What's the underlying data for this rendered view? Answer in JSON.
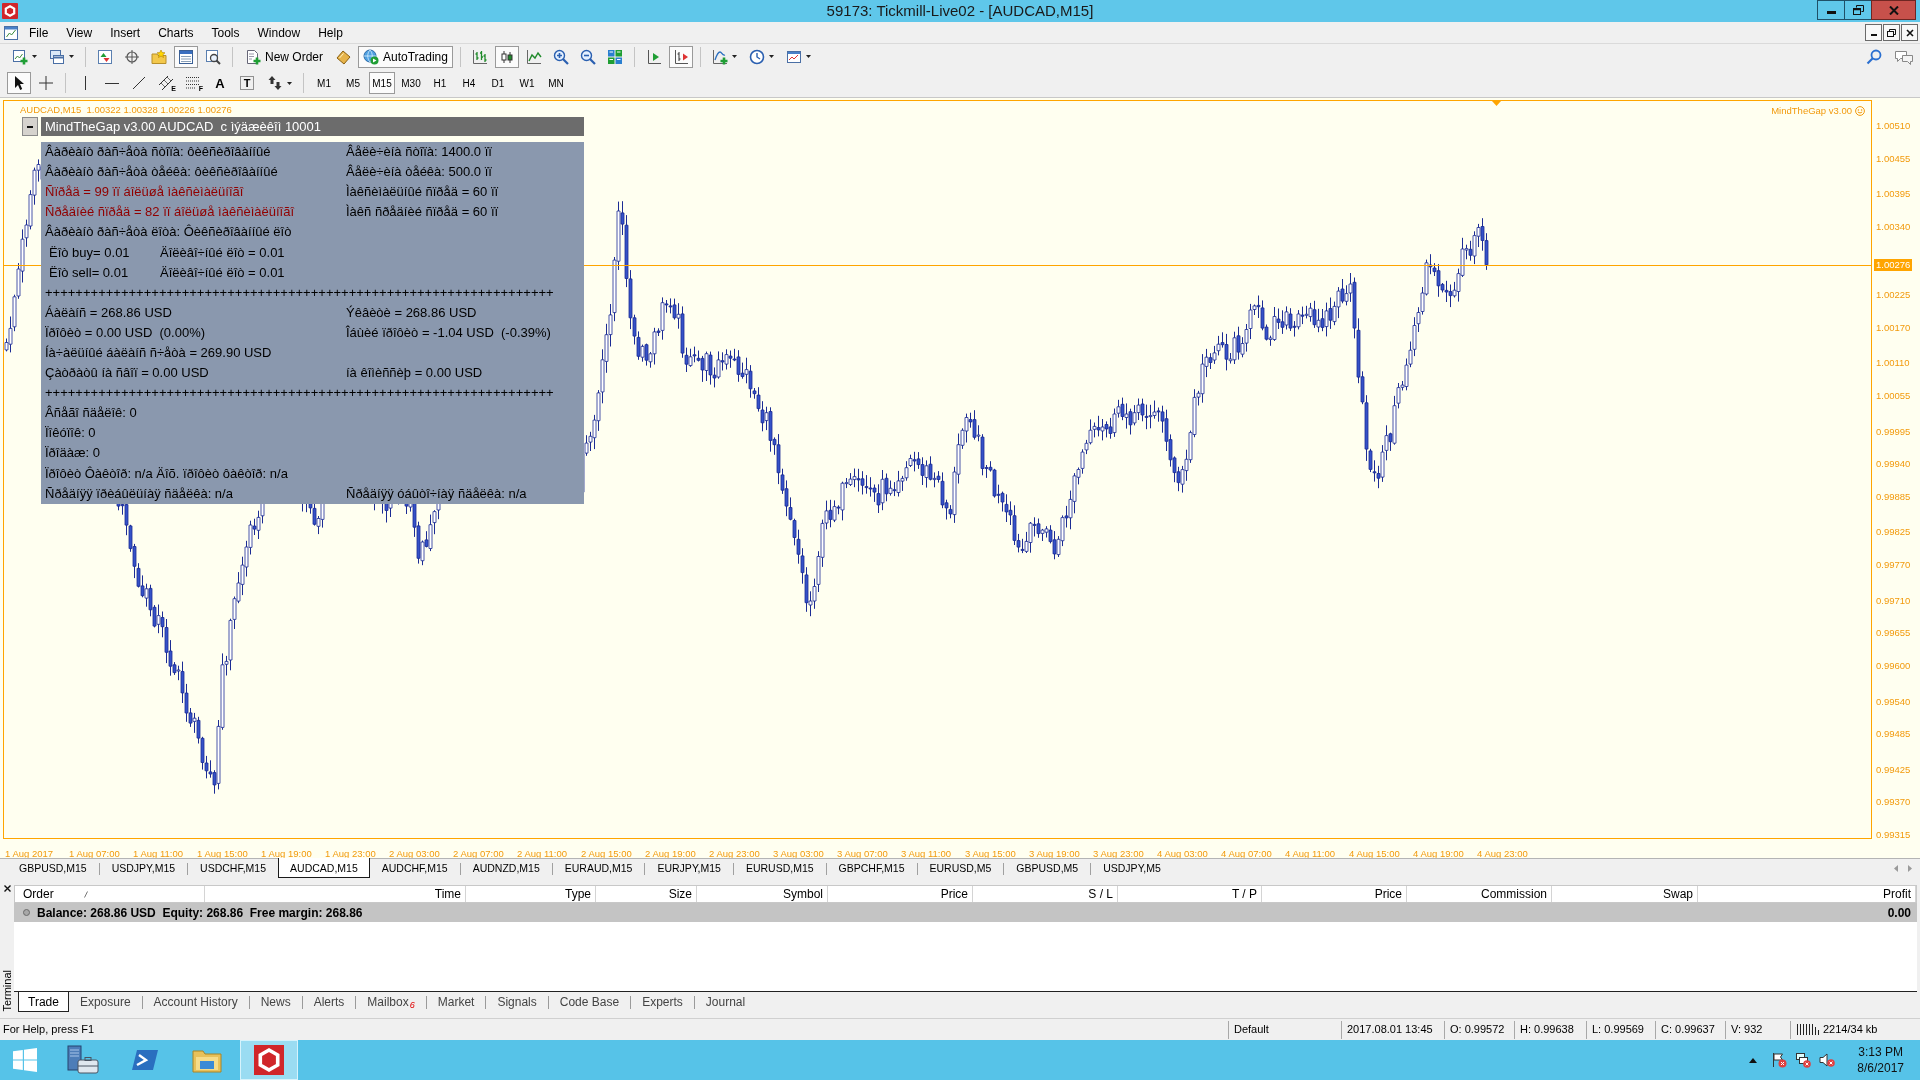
{
  "window": {
    "title": "59173: Tickmill-Live02 - [AUDCAD,M15]"
  },
  "menu": [
    "File",
    "View",
    "Insert",
    "Charts",
    "Tools",
    "Window",
    "Help"
  ],
  "toolbar": {
    "buttons": [
      {
        "pressed": false
      },
      {
        "pressed": false
      },
      {
        "pressed": false
      },
      {
        "pressed": false
      },
      {
        "pressed": false
      },
      {
        "pressed": true
      },
      {
        "pressed": false
      },
      {
        "label": "New Order",
        "pressed": false
      },
      {
        "pressed": false
      },
      {
        "label": "AutoTrading",
        "pressed": true
      },
      {
        "pressed": false
      },
      {
        "pressed": true
      },
      {
        "pressed": false
      },
      {
        "pressed": false
      },
      {
        "pressed": false
      },
      {
        "pressed": false
      },
      {
        "pressed": false
      },
      {
        "pressed": true
      },
      {
        "pressed": false
      },
      {
        "pressed": false
      },
      {
        "pressed": false
      }
    ]
  },
  "drawing_toolbar": {
    "tools": [
      {
        "pressed": true
      },
      {
        "pressed": false
      },
      {
        "pressed": false
      },
      {
        "pressed": false
      },
      {
        "pressed": false
      },
      {
        "glyph": "E",
        "pressed": false
      },
      {
        "glyph": "F",
        "pressed": false
      },
      {
        "glyph": "A",
        "pressed": false
      },
      {
        "glyph": "T",
        "pressed": false
      },
      {
        "pressed": false
      }
    ],
    "timeframes": [
      {
        "label": "M1",
        "selected": false
      },
      {
        "label": "M5",
        "selected": false
      },
      {
        "label": "M15",
        "selected": true
      },
      {
        "label": "M30",
        "selected": false
      },
      {
        "label": "H1",
        "selected": false
      },
      {
        "label": "H4",
        "selected": false
      },
      {
        "label": "D1",
        "selected": false
      },
      {
        "label": "W1",
        "selected": false
      },
      {
        "label": "MN",
        "selected": false
      }
    ]
  },
  "chart": {
    "info": "AUDCAD,M15  1.00322 1.00328 1.00226 1.00276",
    "indicator": "MindTheGap v3.00",
    "price_labels": [
      "1.00510",
      "1.00455",
      "1.00395",
      "1.00340",
      "1.00225",
      "1.00170",
      "1.00110",
      "1.00055",
      "0.99995",
      "0.99940",
      "0.99885",
      "0.99825",
      "0.99770",
      "0.99710",
      "0.99655",
      "0.99600",
      "0.99540",
      "0.99485",
      "0.99425",
      "0.99370",
      "0.99315"
    ],
    "current_price": "1.00276",
    "time_labels": [
      "1 Aug 2017",
      "1 Aug 07:00",
      "1 Aug 11:00",
      "1 Aug 15:00",
      "1 Aug 19:00",
      "1 Aug 23:00",
      "2 Aug 03:00",
      "2 Aug 07:00",
      "2 Aug 11:00",
      "2 Aug 15:00",
      "2 Aug 19:00",
      "2 Aug 23:00",
      "3 Aug 03:00",
      "3 Aug 07:00",
      "3 Aug 11:00",
      "3 Aug 15:00",
      "3 Aug 19:00",
      "3 Aug 23:00",
      "4 Aug 03:00",
      "4 Aug 07:00",
      "4 Aug 11:00",
      "4 Aug 15:00",
      "4 Aug 19:00",
      "4 Aug 23:00"
    ]
  },
  "panel": {
    "title": "MindTheGap v3.00 AUDCAD  c ìýäæèêîì 10001",
    "rows": [
      {
        "kind": "pair",
        "cells": [
          {
            "text": "Âàðèàíò ðàñ÷åòà ñòîïà: ôèêñèðîâàííûé",
            "alert": false
          },
          {
            "text": "Âåëè÷èíà ñòîïà: 1400.0 ïï",
            "alert": false
          }
        ]
      },
      {
        "kind": "pair",
        "cells": [
          {
            "text": "Âàðèàíò ðàñ÷åòà òåéêà: ôèêñèðîâàííûé",
            "alert": false
          },
          {
            "text": "Âåëè÷èíà òåéêà: 500.0 ïï",
            "alert": false
          }
        ]
      },
      {
        "kind": "pair",
        "cells": [
          {
            "text": "Ñïðåä = 99 ïï áîëüøå ìàêñèìàëüíîãî",
            "alert": true
          },
          {
            "text": "Ìàêñèìàëüíûé ñïðåä = 60 ïï",
            "alert": false
          }
        ]
      },
      {
        "kind": "pair",
        "cells": [
          {
            "text": "Ñðåäíèé ñïðåä = 82 ïï áîëüøå ìàêñèìàëüíîãî",
            "alert": true
          },
          {
            "text": "Ìàêñ ñðåäíèé ñïðåä = 60 ïï",
            "alert": false
          }
        ]
      },
      {
        "kind": "single",
        "cells": [
          {
            "text": "Âàðèàíò ðàñ÷åòà ëîòà: Ôèêñèðîâàííûé ëîò",
            "alert": false
          }
        ]
      },
      {
        "kind": "lot",
        "cells": [
          {
            "text": "Ëîò buy= 0.01",
            "alert": false
          },
          {
            "text": "Äîëèâî÷íûé ëîò = 0.01",
            "alert": false
          }
        ]
      },
      {
        "kind": "lot",
        "cells": [
          {
            "text": "Ëîò sell= 0.01",
            "alert": false
          },
          {
            "text": "Äîëèâî÷íûé ëîò = 0.01",
            "alert": false
          }
        ]
      },
      {
        "kind": "rule",
        "cells": [
          {
            "text": "+++++++++++++++++++++++++++++++++++++++++++++++++++++++++++++++++++",
            "alert": false
          }
        ]
      },
      {
        "kind": "pair",
        "cells": [
          {
            "text": "Áàëàíñ = 268.86 USD",
            "alert": false
          },
          {
            "text": "Ýêâèòè = 268.86 USD",
            "alert": false
          }
        ]
      },
      {
        "kind": "pair",
        "cells": [
          {
            "text": "Ïðîôèò = 0.00 USD  (0.00%)",
            "alert": false
          },
          {
            "text": "Îáùèé ïðîôèò = -1.04 USD  (-0.39%)",
            "alert": false
          }
        ]
      },
      {
        "kind": "single",
        "cells": [
          {
            "text": "Íà÷àëüíûé áàëàíñ ñ÷åòà = 269.90 USD",
            "alert": false
          }
        ]
      },
      {
        "kind": "pair",
        "cells": [
          {
            "text": "Çàòðàòû íà ñâîï = 0.00 USD",
            "alert": false
          },
          {
            "text": "íà êîìèññèþ = 0.00 USD",
            "alert": false
          }
        ]
      },
      {
        "kind": "rule",
        "cells": [
          {
            "text": "+++++++++++++++++++++++++++++++++++++++++++++++++++++++++++++++++++",
            "alert": false
          }
        ]
      },
      {
        "kind": "single",
        "cells": [
          {
            "text": "Âñåãî ñäåëîê: 0",
            "alert": false
          }
        ]
      },
      {
        "kind": "single",
        "cells": [
          {
            "text": "Ïîêóïîê: 0",
            "alert": false
          }
        ]
      },
      {
        "kind": "single",
        "cells": [
          {
            "text": "Ïðîäàæ: 0",
            "alert": false
          }
        ]
      },
      {
        "kind": "single",
        "cells": [
          {
            "text": "Ïðîôèò Ôàêòîð: n/a Äîõ. ïðîôèò ôàêòîð: n/a",
            "alert": false
          }
        ]
      },
      {
        "kind": "pair",
        "cells": [
          {
            "text": "Ñðåäíÿÿ ïðèáûëüíàÿ ñäåëêà: n/a",
            "alert": false
          },
          {
            "text": "Ñðåäíÿÿ óáûòî÷íàÿ ñäåëêà: n/a",
            "alert": false
          }
        ]
      }
    ]
  },
  "chart_tabs": [
    {
      "label": "GBPUSD,M15",
      "selected": false
    },
    {
      "label": "USDJPY,M15",
      "selected": false
    },
    {
      "label": "USDCHF,M15",
      "selected": false
    },
    {
      "label": "AUDCAD,M15",
      "selected": true
    },
    {
      "label": "AUDCHF,M15",
      "selected": false
    },
    {
      "label": "AUDNZD,M15",
      "selected": false
    },
    {
      "label": "EURAUD,M15",
      "selected": false
    },
    {
      "label": "EURJPY,M15",
      "selected": false
    },
    {
      "label": "EURUSD,M15",
      "selected": false
    },
    {
      "label": "GBPCHF,M15",
      "selected": false
    },
    {
      "label": "EURUSD,M5",
      "selected": false
    },
    {
      "label": "GBPUSD,M5",
      "selected": false
    },
    {
      "label": "USDJPY,M5",
      "selected": false
    }
  ],
  "terminal": {
    "title": "Terminal",
    "columns": [
      "Order",
      "Time",
      "Type",
      "Size",
      "Symbol",
      "Price",
      "S / L",
      "T / P",
      "Price",
      "Commission",
      "Swap",
      "Profit"
    ],
    "summary": "Balance: 268.86 USD  Equity: 268.86  Free margin: 268.86",
    "profit": "0.00",
    "tabs": [
      {
        "label": "Trade",
        "selected": true
      },
      {
        "label": "Exposure",
        "selected": false
      },
      {
        "label": "Account History",
        "selected": false
      },
      {
        "label": "News",
        "selected": false
      },
      {
        "label": "Alerts",
        "selected": false
      },
      {
        "label": "Mailbox",
        "selected": false,
        "badge": "6"
      },
      {
        "label": "Market",
        "selected": false
      },
      {
        "label": "Signals",
        "selected": false
      },
      {
        "label": "Code Base",
        "selected": false
      },
      {
        "label": "Experts",
        "selected": false
      },
      {
        "label": "Journal",
        "selected": false
      }
    ]
  },
  "status_bar": {
    "help": "For Help, press F1",
    "fields": [
      "Default",
      "2017.08.01 13:45",
      "O: 0.99572",
      "H: 0.99638",
      "L: 0.99569",
      "C: 0.99637",
      "V: 932"
    ],
    "traffic": "2214/34 kb"
  },
  "taskbar": {
    "apps": [
      {
        "active": false
      },
      {
        "active": false
      },
      {
        "active": false
      },
      {
        "active": true
      }
    ],
    "time": "3:13 PM",
    "date": "8/6/2017"
  }
}
